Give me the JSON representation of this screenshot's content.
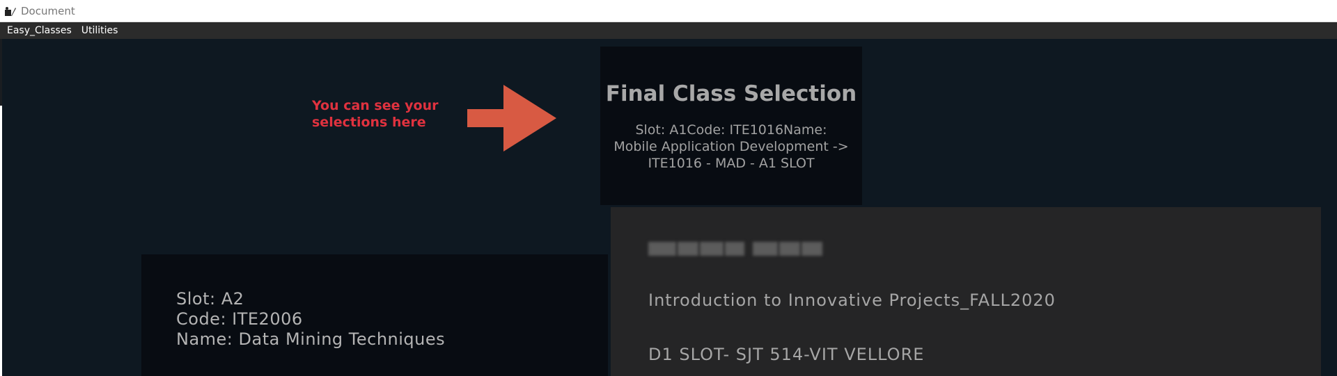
{
  "window": {
    "title": "Document",
    "icon": "app-icon"
  },
  "menu": {
    "items": [
      {
        "label": "Easy_Classes"
      },
      {
        "label": "Utilities"
      }
    ]
  },
  "tip": {
    "text": "You can see your selections here",
    "arrow_color": "#d85a43",
    "text_color": "#e0323f"
  },
  "final_selection": {
    "heading": "Final Class Selection",
    "details": "Slot: A1Code: ITE1016Name: Mobile Application Development -> ITE1016 - MAD - A1 SLOT"
  },
  "class_card": {
    "slot": "Slot: A2",
    "code": "Code: ITE2006",
    "name": "Name: Data Mining Techniques"
  },
  "project_card": {
    "course": "Introduction to Innovative Projects_FALL2020",
    "slot_room": "D1 SLOT- SJT 514-VIT VELLORE"
  },
  "colors": {
    "content_bg": "#0e1821",
    "card_bg": "#080c12",
    "project_bg": "#252526",
    "menubar_bg": "#2b2b2b"
  }
}
